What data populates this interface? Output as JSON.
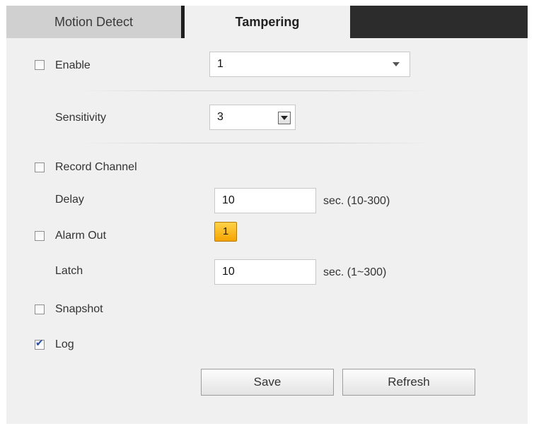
{
  "tabs": [
    {
      "label": "Motion Detect",
      "active": false
    },
    {
      "label": "Tampering",
      "active": true
    }
  ],
  "enable": {
    "label": "Enable",
    "checked": false,
    "select_value": "1"
  },
  "sensitivity": {
    "label": "Sensitivity",
    "value": "3"
  },
  "record_channel": {
    "label": "Record Channel",
    "checked": false
  },
  "delay": {
    "label": "Delay",
    "value": "10",
    "unit": "sec.  (10-300)"
  },
  "alarm_out": {
    "label": "Alarm Out",
    "checked": false,
    "channel": "1",
    "channel_color": "#f5b400"
  },
  "latch": {
    "label": "Latch",
    "value": "10",
    "unit": "sec.  (1~300)"
  },
  "snapshot": {
    "label": "Snapshot",
    "checked": false
  },
  "log": {
    "label": "Log",
    "checked": true
  },
  "buttons": {
    "save": "Save",
    "refresh": "Refresh"
  }
}
